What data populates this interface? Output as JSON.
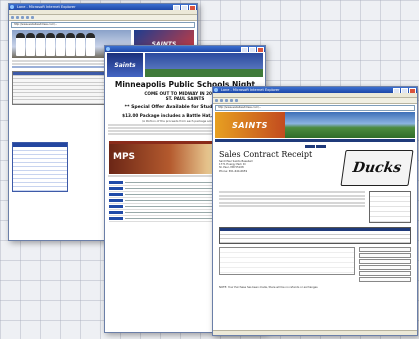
{
  "window1": {
    "title": "Lone - Microsoft Internet Explorer",
    "address": "http://www.websiteaddress.com/...",
    "banner_logo": "SAINTS",
    "grid_header": ""
  },
  "window2": {
    "title": "",
    "banner_logo": "Saints",
    "headline": "Minneapolis Public Schools Night",
    "sub1": "COME OUT TO MIDWAY IN 2008 TO",
    "sub2": "ST. PAUL SAINTS",
    "offer": "** Special Offer Available for Students, Family,",
    "package": "$13.00 Package includes a Battle Hat, Game Ticket &",
    "fine1": "(A Portion of the proceeds from each package sold goes back",
    "mps_bar": "",
    "mps_logo": "MPS"
  },
  "window3": {
    "title": "Lone - Microsoft Internet Explorer",
    "address": "http://www.websiteaddress.com/...",
    "banner_logo": "SAINTS",
    "receipt_title": "Sales Contract Receipt",
    "addr_lines": [
      "Saint Paul Saints Baseball",
      "1771 Energy Park Dr",
      "St. Paul, MN 55108",
      "Phone: 651-644-6659"
    ],
    "ducks_logo": "Ducks",
    "note": "NOTE: Your Purchase has been made, there will be no refunds or exchanges"
  }
}
